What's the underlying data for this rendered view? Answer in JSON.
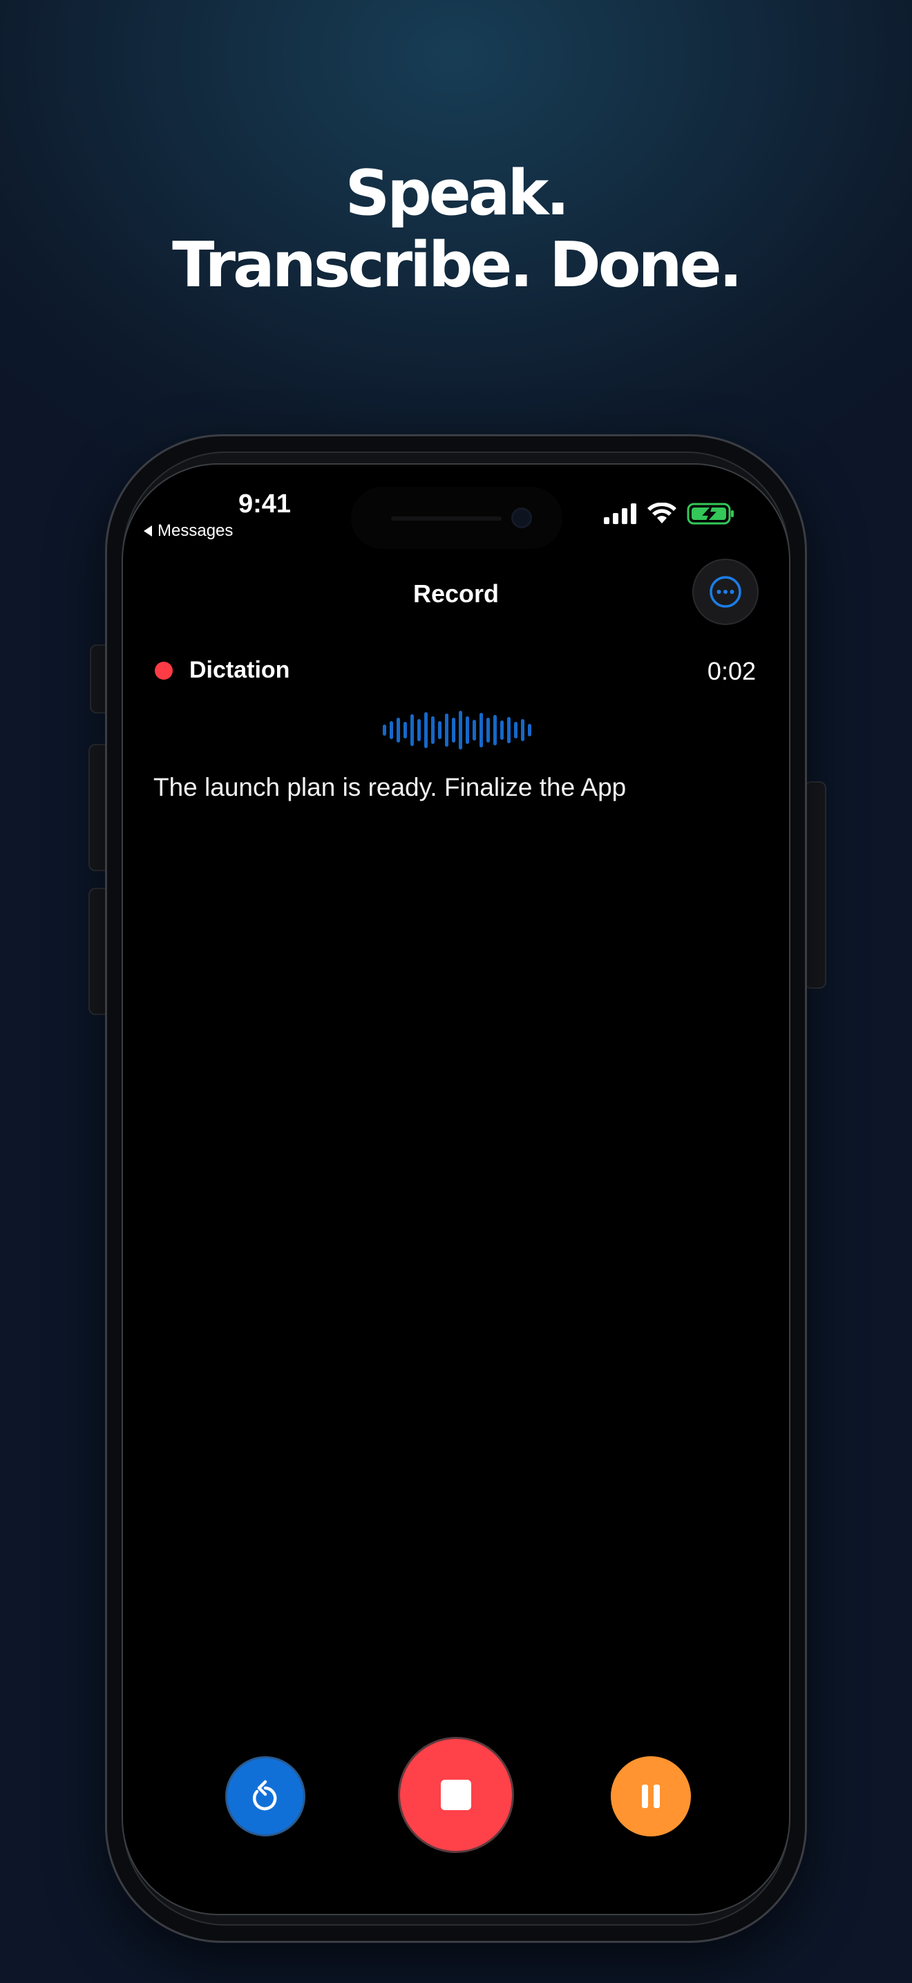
{
  "headline": {
    "line1": "Speak.",
    "line2": "Transcribe. Done."
  },
  "status_bar": {
    "time": "9:41",
    "back_label": "Messages"
  },
  "header": {
    "title": "Record"
  },
  "recording": {
    "mode": "Dictation",
    "elapsed": "0:02"
  },
  "transcript": "The launch plan is ready. Finalize the App",
  "colors": {
    "accent_blue": "#1170d8",
    "record_red": "#ff4149",
    "pause_orange": "#ff9430",
    "battery_green": "#34c759"
  },
  "icons": {
    "more": "ellipsis-circle-icon",
    "restart": "arrow-counterclockwise-icon",
    "stop": "stop-square-icon",
    "pause": "pause-icon"
  }
}
